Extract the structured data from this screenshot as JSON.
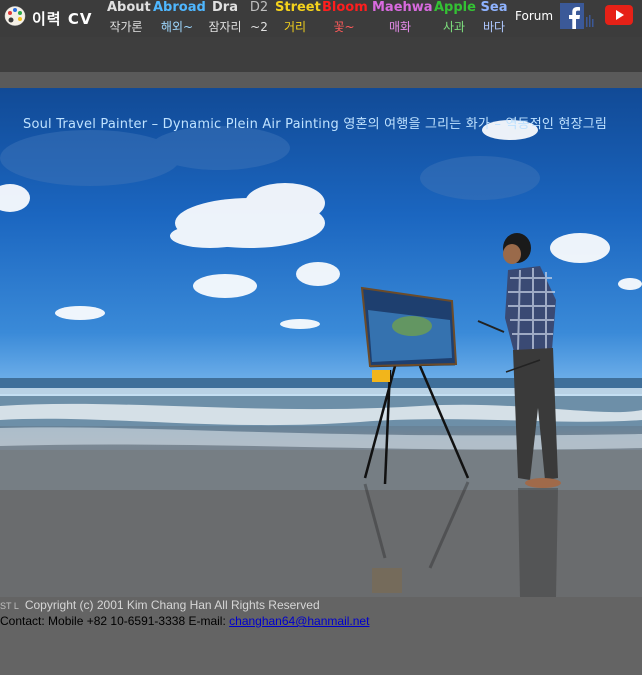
{
  "header": {
    "cv_label": "이력 CV",
    "nav": [
      {
        "en": "About",
        "ko": "작가론",
        "color": "#e0e0e0",
        "ko_color": "#e0e0e0"
      },
      {
        "en": "Abroad",
        "ko": "해외~",
        "color": "#4fb7ff",
        "ko_color": "#9fd8ff"
      },
      {
        "en": "Dra",
        "ko": "잠자리",
        "color": "#e0e0e0",
        "ko_color": "#e0e0e0"
      },
      {
        "en": "D2",
        "ko": "~2",
        "color": "#bfbfbf",
        "ko_color": "#e0e0e0"
      },
      {
        "en": "Street",
        "ko": "거리",
        "color": "#f4d21c",
        "ko_color": "#f4d21c"
      },
      {
        "en": "Bloom",
        "ko": "꽃~",
        "color": "#ff1e1e",
        "ko_color": "#ff5a5a"
      },
      {
        "en": "Maehwa",
        "ko": "매화",
        "color": "#d86adf",
        "ko_color": "#e58cea"
      },
      {
        "en": "Apple",
        "ko": "사과",
        "color": "#34c234",
        "ko_color": "#7ee07e"
      },
      {
        "en": "Sea",
        "ko": "바다",
        "color": "#8fb3ff",
        "ko_color": "#aec8ff"
      }
    ],
    "forum_label": "Forum",
    "icons": {
      "logo": "palette-icon",
      "facebook": "facebook-icon",
      "youtube": "youtube-icon"
    }
  },
  "hero": {
    "tagline": "Soul Travel Painter – Dynamic Plein Air Painting 영혼의 여행을 그리는 화가 – 역동적인 현장그림"
  },
  "footer": {
    "st": "ST  L",
    "copyright": "Copyright (c) 2001 Kim Chang Han  All Rights Reserved",
    "contact_prefix": "Contact: Mobile +82 10-6591-3338    E-mail: ",
    "email": "changhan64@hanmail.net"
  }
}
